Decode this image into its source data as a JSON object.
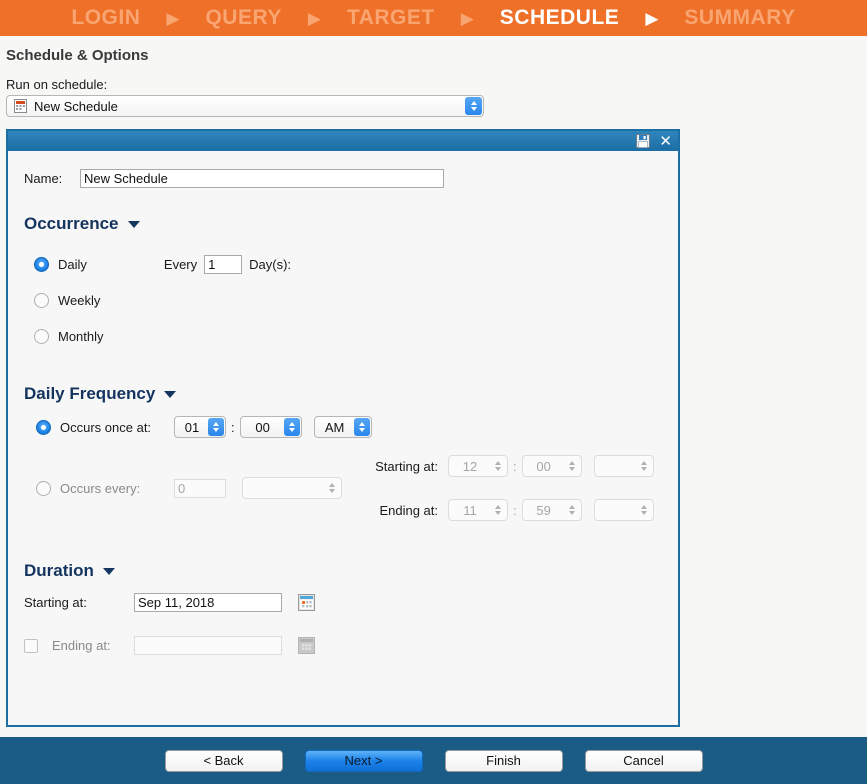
{
  "wizard": {
    "steps": [
      {
        "label": "LOGIN",
        "active": false
      },
      {
        "label": "QUERY",
        "active": false
      },
      {
        "label": "TARGET",
        "active": false
      },
      {
        "label": "SCHEDULE",
        "active": true
      },
      {
        "label": "SUMMARY",
        "active": false
      }
    ],
    "arrow_glyph": "▶",
    "bar_color": "#ef7028",
    "active_color": "#ffffff",
    "inactive_color": "#f9a571"
  },
  "page": {
    "title": "Schedule & Options",
    "run_on_schedule_label": "Run on schedule:",
    "schedule_select_value": "New Schedule",
    "schedule_select_icon": "schedule-document-icon"
  },
  "dialog": {
    "titlebar": {
      "save_icon": "save-floppy-icon",
      "close_icon": "close-icon",
      "close_glyph": "✕",
      "color": "#1c6ea4"
    },
    "name": {
      "label": "Name:",
      "value": "New Schedule"
    },
    "occurrence": {
      "heading": "Occurrence",
      "options": [
        {
          "label": "Daily",
          "selected": true
        },
        {
          "label": "Weekly",
          "selected": false
        },
        {
          "label": "Monthly",
          "selected": false
        }
      ],
      "every_label": "Every",
      "every_value": "1",
      "days_label": "Day(s):"
    },
    "daily_frequency": {
      "heading": "Daily Frequency",
      "once": {
        "label": "Occurs once at:",
        "selected": true,
        "hour": "01",
        "minute": "00",
        "meridiem": "AM",
        "colon": ":"
      },
      "every": {
        "label": "Occurs every:",
        "selected": false,
        "interval_value": "0",
        "unit_value": "",
        "starting_label": "Starting at:",
        "starting_hour": "12",
        "starting_minute": "00",
        "starting_meridiem": "",
        "ending_label": "Ending at:",
        "ending_hour": "11",
        "ending_minute": "59",
        "ending_meridiem": "",
        "colon": ":"
      }
    },
    "duration": {
      "heading": "Duration",
      "starting_label": "Starting at:",
      "starting_value": "Sep 11, 2018",
      "starting_calendar_icon": "calendar-icon",
      "ending_label": "Ending at:",
      "ending_value": "",
      "ending_checked": false,
      "ending_calendar_icon": "calendar-icon-disabled"
    }
  },
  "footer": {
    "buttons": [
      {
        "label": "< Back",
        "primary": false
      },
      {
        "label": "Next >",
        "primary": true
      },
      {
        "label": "Finish",
        "primary": false
      },
      {
        "label": "Cancel",
        "primary": false
      }
    ],
    "bar_color": "#1b5c87"
  }
}
